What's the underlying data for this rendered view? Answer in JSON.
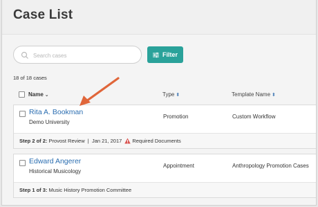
{
  "header": {
    "title": "Case List"
  },
  "search": {
    "placeholder": "Search cases",
    "value": ""
  },
  "filter": {
    "label": "Filter"
  },
  "count_text": "18 of 18 cases",
  "columns": {
    "name": "Name",
    "type": "Type",
    "template": "Template Name"
  },
  "icons": {
    "search": "search-icon",
    "filter": "sliders-icon",
    "sort": "sort-icon",
    "warning": "warning-icon",
    "annotation": "arrow-annotation"
  },
  "colors": {
    "accent": "#2aa29a",
    "link": "#2a6db0",
    "warning": "#d9534f",
    "annotation": "#e0663a"
  },
  "cases": [
    {
      "name": "Rita A. Bookman",
      "institution": "Demo University",
      "type": "Promotion",
      "template": "Custom Workflow",
      "step_label": "Step 2 of 2:",
      "step_text": "Provost Review",
      "date": "Jan 21, 2017",
      "alert": "Required Documents"
    },
    {
      "name": "Edward Angerer",
      "institution": "Historical Musicology",
      "type": "Appointment",
      "template": "Anthropology Promotion Cases",
      "step_label": "Step 1 of 3:",
      "step_text": "Music History Promotion Committee"
    }
  ]
}
